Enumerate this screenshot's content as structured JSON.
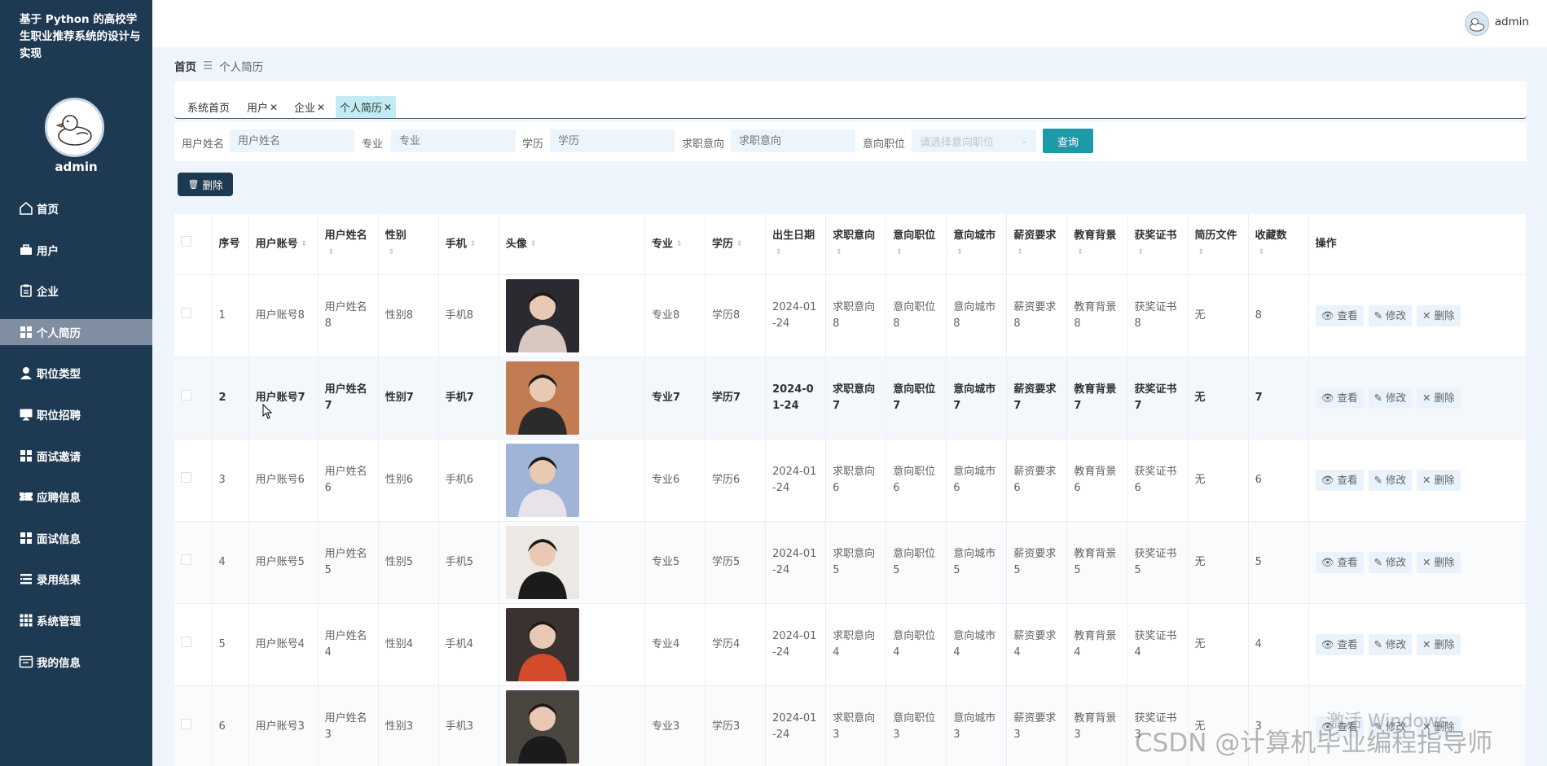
{
  "sidebar": {
    "title": "基于 Python 的高校学生职业推荐系统的设计与实现",
    "username": "admin",
    "items": [
      {
        "label": "首页",
        "icon": "home-icon"
      },
      {
        "label": "用户",
        "icon": "briefcase-icon"
      },
      {
        "label": "企业",
        "icon": "clipboard-icon"
      },
      {
        "label": "个人简历",
        "icon": "grid-icon",
        "active": true
      },
      {
        "label": "职位类型",
        "icon": "person-icon"
      },
      {
        "label": "职位招聘",
        "icon": "monitor-icon"
      },
      {
        "label": "面试邀请",
        "icon": "grid-icon"
      },
      {
        "label": "应聘信息",
        "icon": "ticket-icon"
      },
      {
        "label": "面试信息",
        "icon": "grid-icon"
      },
      {
        "label": "录用结果",
        "icon": "list-icon"
      },
      {
        "label": "系统管理",
        "icon": "apps-icon"
      },
      {
        "label": "我的信息",
        "icon": "window-icon"
      }
    ]
  },
  "header": {
    "username": "admin"
  },
  "breadcrumb": {
    "home": "首页",
    "separator": "☰",
    "current": "个人简历"
  },
  "tabs": [
    {
      "label": "系统首页",
      "closable": false
    },
    {
      "label": "用户",
      "closable": true
    },
    {
      "label": "企业",
      "closable": true
    },
    {
      "label": "个人简历",
      "closable": true,
      "active": true
    }
  ],
  "filters": {
    "name": {
      "label": "用户姓名",
      "placeholder": "用户姓名"
    },
    "major": {
      "label": "专业",
      "placeholder": "专业"
    },
    "education": {
      "label": "学历",
      "placeholder": "学历"
    },
    "intention": {
      "label": "求职意向",
      "placeholder": "求职意向"
    },
    "position": {
      "label": "意向职位",
      "placeholder": "请选择意向职位"
    },
    "search_label": "查询"
  },
  "toolbar": {
    "delete_label": "删除"
  },
  "table": {
    "columns": [
      "序号",
      "用户账号",
      "用户姓名",
      "性别",
      "手机",
      "头像",
      "专业",
      "学历",
      "出生日期",
      "求职意向",
      "意向职位",
      "意向城市",
      "薪资要求",
      "教育背景",
      "获奖证书",
      "简历文件",
      "收藏数",
      "操作"
    ],
    "actions": {
      "view": "查看",
      "edit": "修改",
      "delete": "删除"
    },
    "rows": [
      {
        "index": "1",
        "account": "用户账号8",
        "name": "用户姓名8",
        "gender": "性别8",
        "phone": "手机8",
        "major": "专业8",
        "education": "学历8",
        "birth": "2024-01-24",
        "intention": "求职意向8",
        "position": "意向职位8",
        "city": "意向城市8",
        "salary": "薪资要求8",
        "background": "教育背景8",
        "award": "获奖证书8",
        "resume": "无",
        "favorites": "8"
      },
      {
        "index": "2",
        "account": "用户账号7",
        "name": "用户姓名7",
        "gender": "性别7",
        "phone": "手机7",
        "major": "专业7",
        "education": "学历7",
        "birth": "2024-01-24",
        "intention": "求职意向7",
        "position": "意向职位7",
        "city": "意向城市7",
        "salary": "薪资要求7",
        "background": "教育背景7",
        "award": "获奖证书7",
        "resume": "无",
        "favorites": "7"
      },
      {
        "index": "3",
        "account": "用户账号6",
        "name": "用户姓名6",
        "gender": "性别6",
        "phone": "手机6",
        "major": "专业6",
        "education": "学历6",
        "birth": "2024-01-24",
        "intention": "求职意向6",
        "position": "意向职位6",
        "city": "意向城市6",
        "salary": "薪资要求6",
        "background": "教育背景6",
        "award": "获奖证书6",
        "resume": "无",
        "favorites": "6"
      },
      {
        "index": "4",
        "account": "用户账号5",
        "name": "用户姓名5",
        "gender": "性别5",
        "phone": "手机5",
        "major": "专业5",
        "education": "学历5",
        "birth": "2024-01-24",
        "intention": "求职意向5",
        "position": "意向职位5",
        "city": "意向城市5",
        "salary": "薪资要求5",
        "background": "教育背景5",
        "award": "获奖证书5",
        "resume": "无",
        "favorites": "5"
      },
      {
        "index": "5",
        "account": "用户账号4",
        "name": "用户姓名4",
        "gender": "性别4",
        "phone": "手机4",
        "major": "专业4",
        "education": "学历4",
        "birth": "2024-01-24",
        "intention": "求职意向4",
        "position": "意向职位4",
        "city": "意向城市4",
        "salary": "薪资要求4",
        "background": "教育背景4",
        "award": "获奖证书4",
        "resume": "无",
        "favorites": "4"
      },
      {
        "index": "6",
        "account": "用户账号3",
        "name": "用户姓名3",
        "gender": "性别3",
        "phone": "手机3",
        "major": "专业3",
        "education": "学历3",
        "birth": "2024-01-24",
        "intention": "求职意向3",
        "position": "意向职位3",
        "city": "意向城市3",
        "salary": "薪资要求3",
        "background": "教育背景3",
        "award": "获奖证书3",
        "resume": "无",
        "favorites": "3"
      }
    ]
  },
  "watermark": {
    "activate": "激活 Windows",
    "csdn": "CSDN @计算机毕业编程指导师"
  },
  "colors": {
    "sidebar_bg": "#1e3a52",
    "accent": "#1d9aa8",
    "active_tab": "#c2ecf3",
    "page_bg": "#eef5fc"
  }
}
